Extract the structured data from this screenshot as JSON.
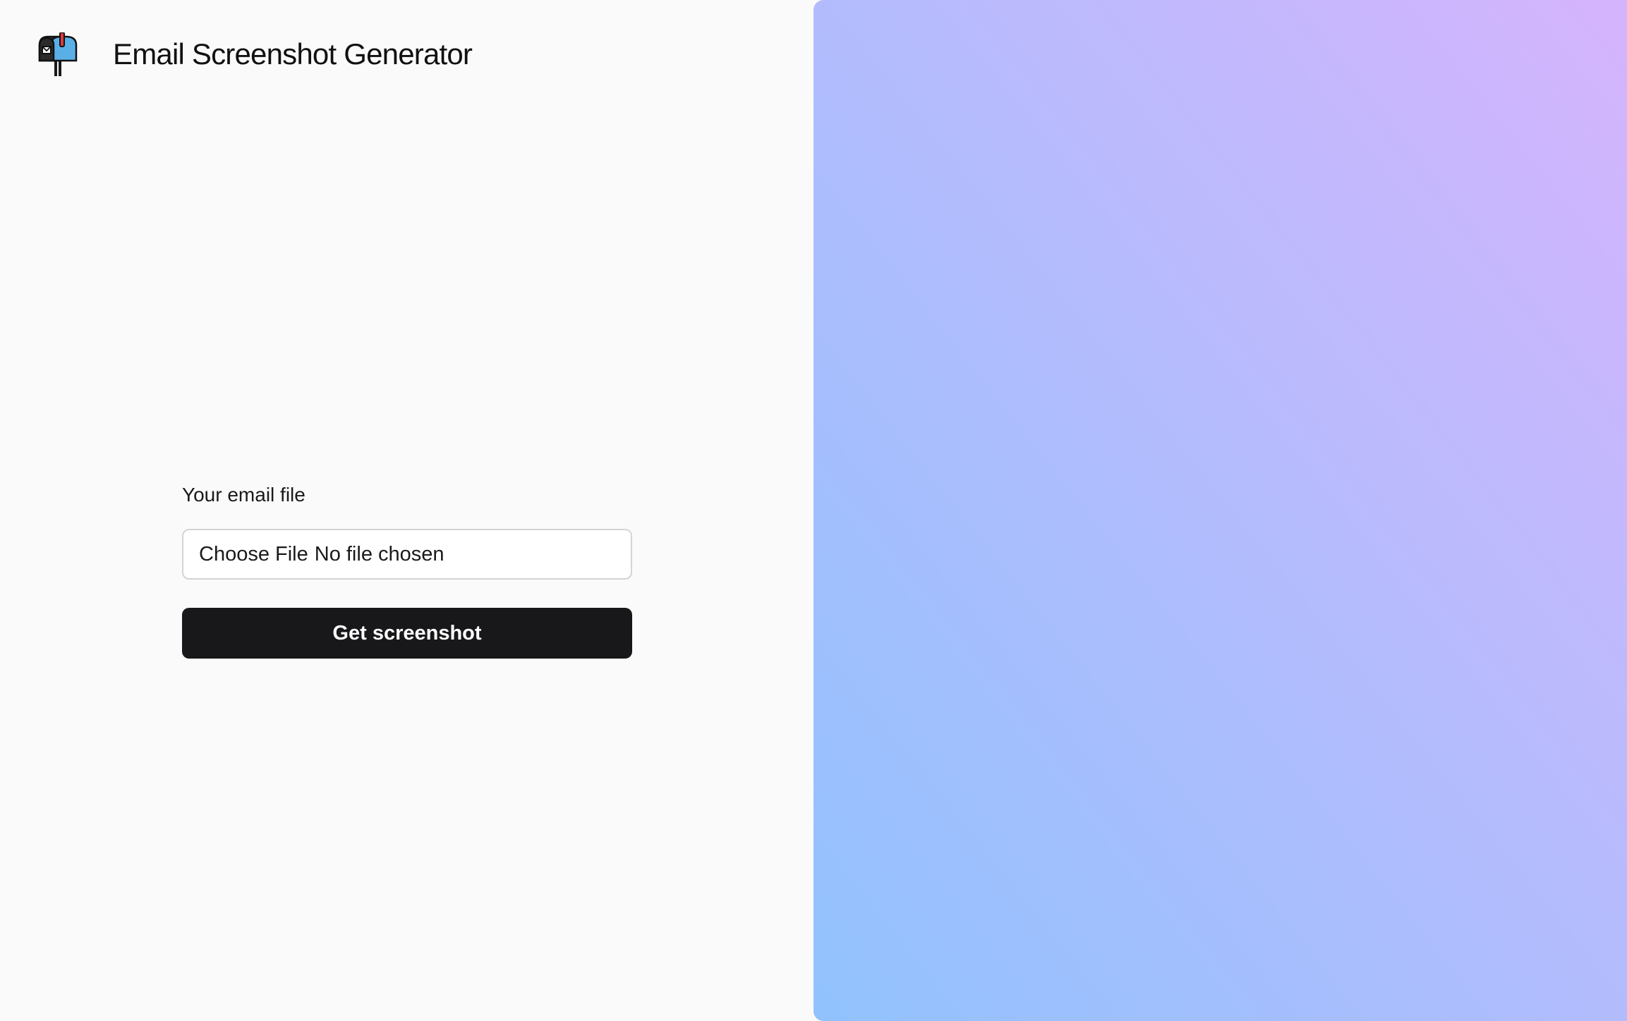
{
  "header": {
    "logo_icon": "mailbox-icon",
    "title": "Email Screenshot Generator"
  },
  "form": {
    "file_label": "Your email file",
    "file_input": {
      "button_label": "Choose File",
      "status_text": "No file chosen"
    },
    "submit_label": "Get screenshot"
  },
  "colors": {
    "background": "#fafafa",
    "button_bg": "#18181b",
    "button_text": "#ffffff",
    "gradient_start": "#91c2fd",
    "gradient_mid": "#b2bcfd",
    "gradient_end": "#d5b4fd"
  }
}
